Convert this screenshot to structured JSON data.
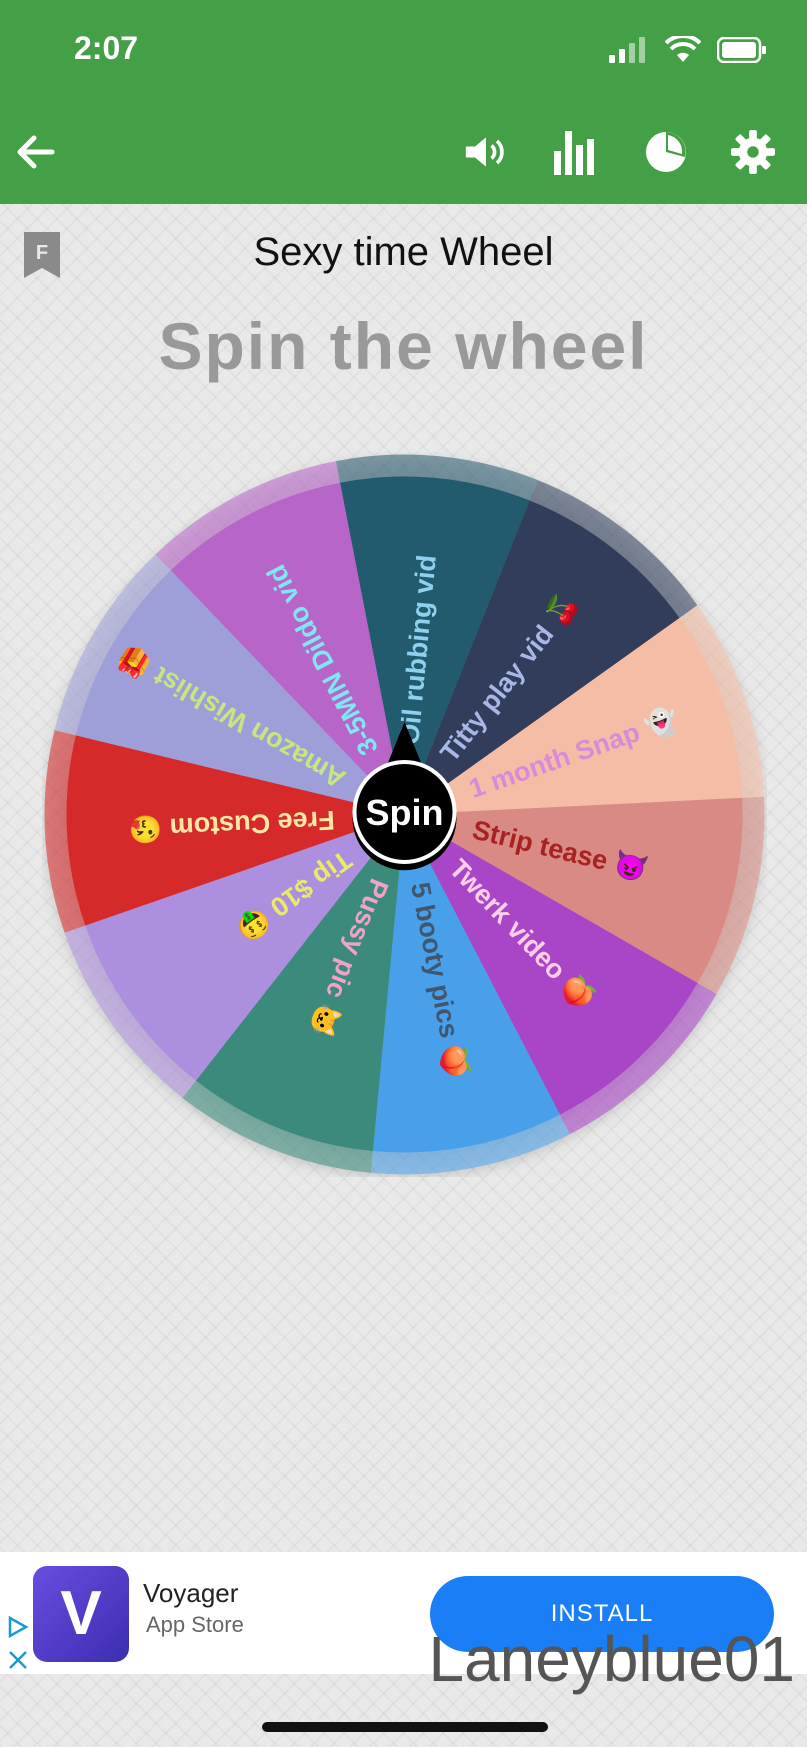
{
  "status": {
    "time": "2:07"
  },
  "toolbar": {
    "back_icon": "arrow-left-icon",
    "icons": [
      "volume-icon",
      "bar-chart-icon",
      "pie-chart-icon",
      "gear-icon"
    ]
  },
  "page": {
    "title": "Sexy time Wheel",
    "subtitle": "Spin the wheel",
    "flag_letter": "F"
  },
  "wheel": {
    "center_label": "Spin",
    "segments": [
      {
        "label": "Oil rubbing vid",
        "color": "#245a6e",
        "text_color": "#8fd0ee"
      },
      {
        "label": "Titty play vid 🍒",
        "color": "#323e5c",
        "text_color": "#a9b7e6"
      },
      {
        "label": "1 month Snap 👻",
        "color": "#f5bda6",
        "text_color": "#d88bd6"
      },
      {
        "label": "Strip tease 😈",
        "color": "#d98a84",
        "text_color": "#a82222"
      },
      {
        "label": "Twerk video 🍑",
        "color": "#a945c7",
        "text_color": "#ffd0ea"
      },
      {
        "label": "5 booty pics 🍑",
        "color": "#4aa0ea",
        "text_color": "#41566e"
      },
      {
        "label": "Pussy pic 🐱",
        "color": "#3a8a7c",
        "text_color": "#f0a3c6"
      },
      {
        "label": "Tip $10 🤑",
        "color": "#ad8fdf",
        "text_color": "#e9ea6c"
      },
      {
        "label": "Free Custom 😘",
        "color": "#d62c2c",
        "text_color": "#ffe7a6"
      },
      {
        "label": "Amazon Wishlist 🎁",
        "color": "#9e9fd8",
        "text_color": "#c6e780"
      },
      {
        "label": "3-5MIN Dildo vid",
        "color": "#b865c9",
        "text_color": "#7ee7f2"
      }
    ]
  },
  "ad": {
    "app_name": "Voyager",
    "store": "App Store",
    "install_label": "INSTALL",
    "logo_letter": "V"
  },
  "watermark": "Laneyblue01"
}
